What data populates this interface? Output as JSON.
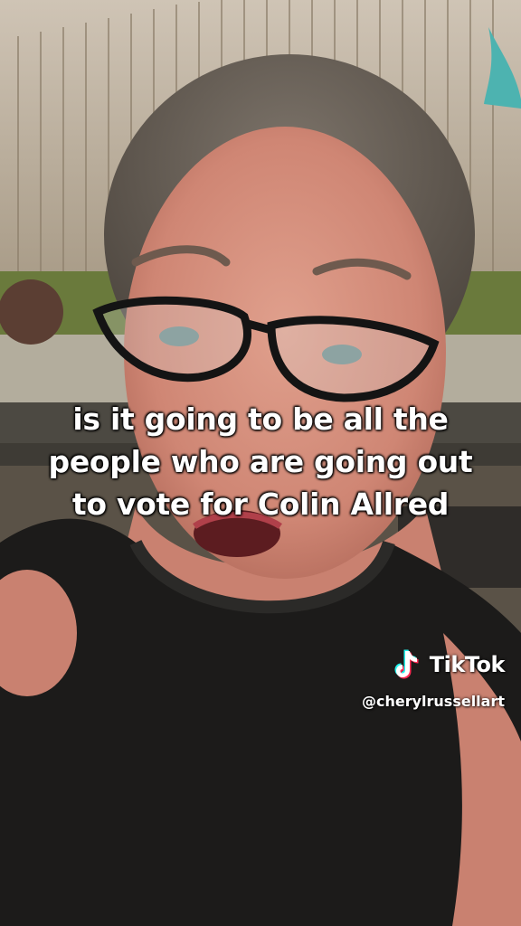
{
  "caption": {
    "lines": [
      "is it going to be all the",
      "people who are going out",
      "to vote for Colin Allred"
    ]
  },
  "watermark": {
    "brand": "TikTok",
    "handle": "@cherylrussellart",
    "logo_icon": "tiktok-note-icon"
  },
  "colors": {
    "caption_text": "#ffffff",
    "logo_cyan": "#25f4ee",
    "logo_red": "#fe2c55"
  }
}
